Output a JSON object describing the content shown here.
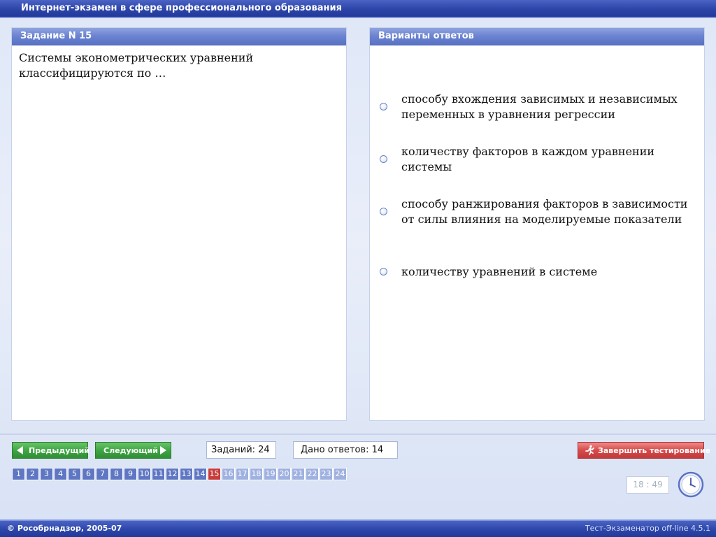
{
  "app": {
    "title": "Интернет-экзамен в сфере профессионального образования"
  },
  "task": {
    "header": "Задание N 15",
    "question": "Системы эконометрических уравнений классифицируются по …"
  },
  "answers": {
    "header": "Варианты ответов",
    "options": [
      "способу вхождения зависимых и независимых переменных в уравнения регрессии",
      "количеству факторов в каждом уравнении системы",
      "способу ранжирования факторов в зависимости от силы влияния на моделируемые показатели",
      "количеству уравнений в системе"
    ]
  },
  "toolbar": {
    "prev_label": "Предыдущий",
    "next_label": "Следующий",
    "tasks_count": "Заданий: 24",
    "answers_count": "Дано ответов: 14",
    "finish_label": "Завершить тестирование",
    "timer": "18 : 49"
  },
  "task_numbers": [
    "1",
    "2",
    "3",
    "4",
    "5",
    "6",
    "7",
    "8",
    "9",
    "10",
    "11",
    "12",
    "13",
    "14",
    "15",
    "16",
    "17",
    "18",
    "19",
    "20",
    "21",
    "22",
    "23",
    "24"
  ],
  "task_states": {
    "current": "15",
    "answered_range": "1-14",
    "pending_range": "16-24"
  },
  "footer": {
    "copyright": "Рособрнадзор, 2005-07",
    "version": "Тест-Экзаменатор off-line 4.5.1"
  },
  "colors": {
    "answered": "#5f77c3",
    "current": "#c63c3c",
    "pending": "#9fb1e0",
    "nav_button": "#3fa643",
    "finish_button": "#d64b4b"
  },
  "icons": {
    "prev": "arrow-left-icon",
    "next": "arrow-right-icon",
    "finish": "running-man-icon",
    "clock": "clock-icon"
  }
}
